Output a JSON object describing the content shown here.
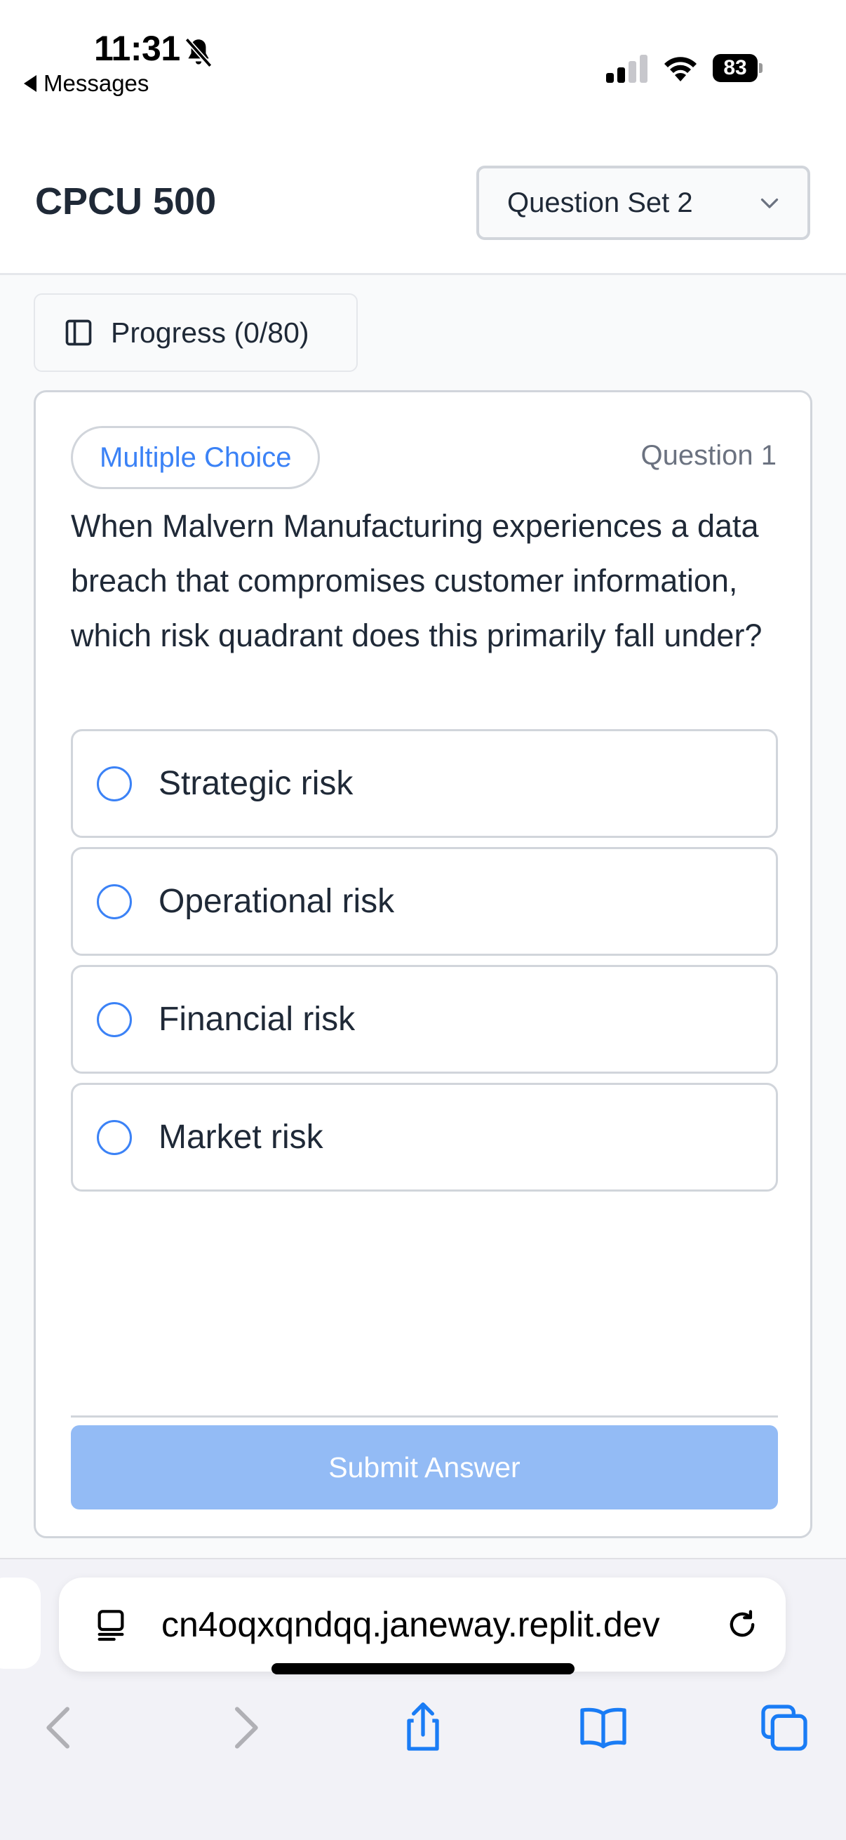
{
  "status_bar": {
    "time": "11:31",
    "back_app": "Messages",
    "battery": "83",
    "icons": [
      "bell-slash-icon",
      "signal-icon",
      "wifi-icon",
      "battery-icon"
    ]
  },
  "header": {
    "title": "CPCU 500",
    "question_set": "Question Set 2"
  },
  "progress": {
    "label": "Progress (0/80)"
  },
  "question": {
    "type": "Multiple Choice",
    "number": "Question 1",
    "text": "When Malvern Manufacturing experiences a data breach that compromises customer information, which risk quadrant does this primarily fall under?",
    "options": [
      {
        "label": "Strategic risk"
      },
      {
        "label": "Operational risk"
      },
      {
        "label": "Financial risk"
      },
      {
        "label": "Market risk"
      }
    ],
    "submit_label": "Submit Answer"
  },
  "browser": {
    "url": "cn4oqxqndqq.janeway.replit.dev",
    "toolbar_icons": [
      "back-icon",
      "forward-icon",
      "share-icon",
      "bookmarks-icon",
      "tabs-icon"
    ]
  },
  "colors": {
    "accent": "#3b82f6",
    "submit_disabled": "#93bbf5",
    "text": "#1f2937",
    "muted": "#6b7280"
  }
}
